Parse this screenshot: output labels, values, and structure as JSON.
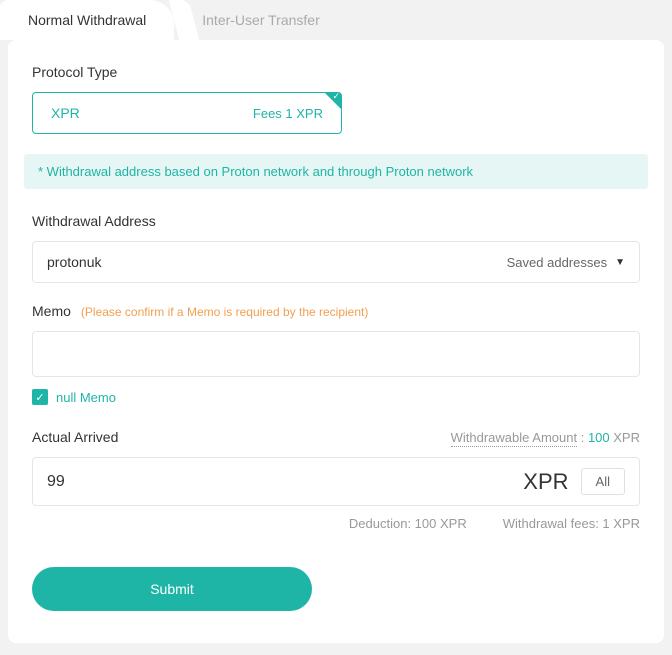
{
  "tabs": {
    "normal_withdrawal": "Normal Withdrawal",
    "inter_user_transfer": "Inter-User Transfer"
  },
  "protocol": {
    "label": "Protocol Type",
    "name": "XPR",
    "fee_text": "Fees  1  XPR"
  },
  "notice": "* Withdrawal address based on Proton network and through Proton network",
  "address": {
    "label": "Withdrawal Address",
    "value": "protonuk",
    "saved_label": "Saved addresses"
  },
  "memo": {
    "label": "Memo",
    "hint": "(Please confirm if a Memo is required by the recipient)",
    "null_label": "null Memo",
    "value": ""
  },
  "amount": {
    "label": "Actual Arrived",
    "withdrawable_label": "Withdrawable Amount",
    "withdrawable_value": "100",
    "withdrawable_unit": "XPR",
    "value": "99",
    "currency": "XPR",
    "all_button": "All",
    "deduction": "Deduction: 100 XPR",
    "withdrawal_fees": "Withdrawal fees: 1 XPR"
  },
  "submit": "Submit"
}
